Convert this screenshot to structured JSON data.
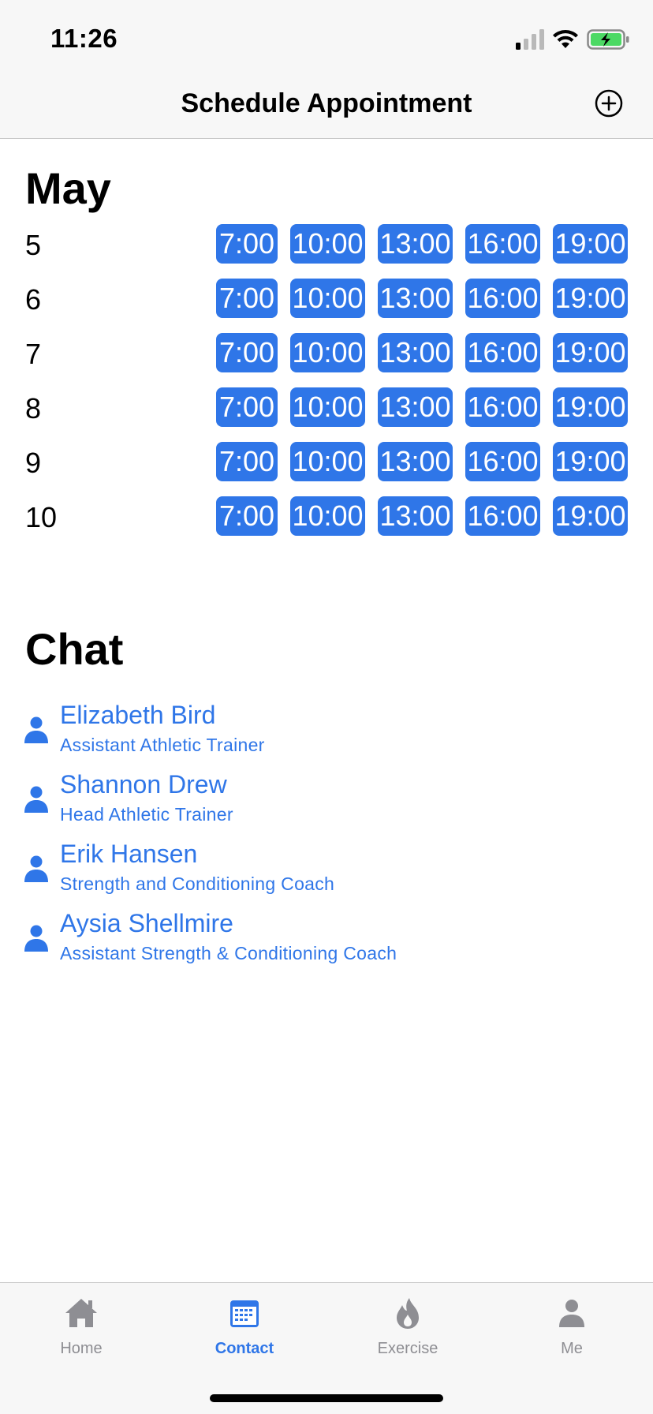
{
  "status_bar": {
    "time": "11:26"
  },
  "nav": {
    "title": "Schedule Appointment",
    "add_icon": "plus-circle-icon"
  },
  "schedule": {
    "month": "May",
    "days": [
      {
        "day": "5",
        "slots": [
          "7:00",
          "10:00",
          "13:00",
          "16:00",
          "19:00"
        ]
      },
      {
        "day": "6",
        "slots": [
          "7:00",
          "10:00",
          "13:00",
          "16:00",
          "19:00"
        ]
      },
      {
        "day": "7",
        "slots": [
          "7:00",
          "10:00",
          "13:00",
          "16:00",
          "19:00"
        ]
      },
      {
        "day": "8",
        "slots": [
          "7:00",
          "10:00",
          "13:00",
          "16:00",
          "19:00"
        ]
      },
      {
        "day": "9",
        "slots": [
          "7:00",
          "10:00",
          "13:00",
          "16:00",
          "19:00"
        ]
      },
      {
        "day": "10",
        "slots": [
          "7:00",
          "10:00",
          "13:00",
          "16:00",
          "19:00"
        ]
      }
    ]
  },
  "chat": {
    "heading": "Chat",
    "contacts": [
      {
        "name": "Elizabeth Bird",
        "role": "Assistant Athletic Trainer",
        "icon": "person-icon"
      },
      {
        "name": "Shannon Drew",
        "role": "Head Athletic Trainer",
        "icon": "person-icon"
      },
      {
        "name": "Erik Hansen",
        "role": "Strength and Conditioning Coach",
        "icon": "person-icon"
      },
      {
        "name": "Aysia Shellmire",
        "role": "Assistant Strength & Conditioning Coach",
        "icon": "person-icon"
      }
    ]
  },
  "tabs": [
    {
      "label": "Home",
      "icon": "house-icon",
      "active": false
    },
    {
      "label": "Contact",
      "icon": "calendar-icon",
      "active": true
    },
    {
      "label": "Exercise",
      "icon": "flame-icon",
      "active": false
    },
    {
      "label": "Me",
      "icon": "person-icon",
      "active": false
    }
  ],
  "colors": {
    "accent": "#2f76e8",
    "inactive": "#8e8e93",
    "battery": "#4cd964"
  }
}
